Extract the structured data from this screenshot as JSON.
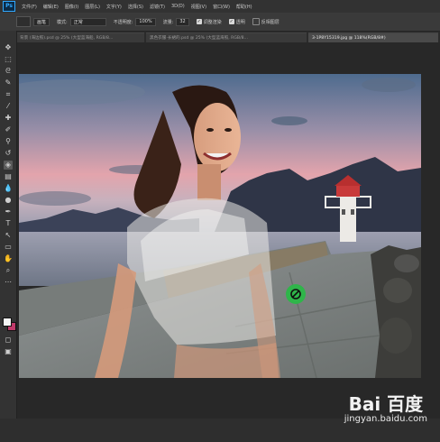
{
  "menu": {
    "logo": "Ps",
    "items": [
      "文件(F)",
      "编辑(E)",
      "图像(I)",
      "图层(L)",
      "文字(Y)",
      "选择(S)",
      "滤镜(T)",
      "3D(D)",
      "视图(V)",
      "窗口(W)",
      "帮助(H)"
    ]
  },
  "options": {
    "tool_name": "画笔",
    "mode_label": "模式:",
    "mode_value": "正常",
    "opacity_label": "不透明度:",
    "opacity_value": "100%",
    "flow_label": "流量:",
    "flow_value": "32",
    "check1": "调整渲染",
    "check2": "透明",
    "check3": "反相图层"
  },
  "tabs": [
    {
      "label": "背景 (海边照).psd @ 25% (大型蓝海船, RGB/8...",
      "active": false
    },
    {
      "label": "黑色衣服·长裙的.psd @ 25% (大型蓝海照, RGB/8...",
      "active": false
    },
    {
      "label": "3-1P8Y15319.jpg @ 118%(RGB/8#)",
      "active": true
    }
  ],
  "canvas": {
    "tooltip_icon": "no-entry-cursor-icon"
  },
  "watermark": {
    "logo": "Bai 百度",
    "url": "jingyan.baidu.com"
  },
  "colors": {
    "foreground": "#f4f4f4",
    "background": "#c03a6a"
  }
}
